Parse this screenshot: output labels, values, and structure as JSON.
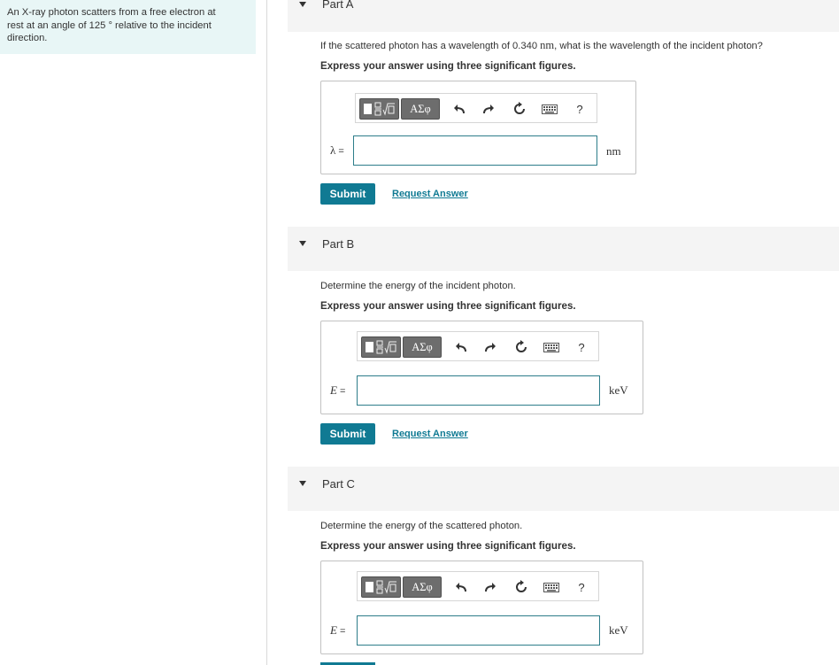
{
  "problem": {
    "line1": "An X-ray photon scatters from a free electron at",
    "line2": "rest at an angle of 125 ° relative to the incident",
    "line3": "direction."
  },
  "toolbar": {
    "symbols_label": "ΑΣφ",
    "help_label": "?",
    "templates_icon": "fraction-sqrt-templates-icon",
    "undo_icon": "undo-arrow-icon",
    "redo_icon": "redo-arrow-icon",
    "reset_icon": "reset-circular-arrow-icon",
    "keyboard_icon": "keyboard-icon"
  },
  "parts": [
    {
      "title": "Part A",
      "question_before": "If the scattered photon has a wavelength of 0.340",
      "question_unit": "nm",
      "question_after": ", what is the wavelength of the incident photon?",
      "instructions": "Express your answer using three significant figures.",
      "variable": "λ",
      "equals": "=",
      "unit": "nm",
      "input_value": "",
      "submit_label": "Submit",
      "request_label": "Request Answer"
    },
    {
      "title": "Part B",
      "question": "Determine the energy of the incident photon.",
      "instructions": "Express your answer using three significant figures.",
      "variable": "E",
      "equals": "=",
      "unit": "keV",
      "input_value": "",
      "submit_label": "Submit",
      "request_label": "Request Answer"
    },
    {
      "title": "Part C",
      "question": "Determine the energy of the scattered photon.",
      "instructions": "Express your answer using three significant figures.",
      "variable": "E",
      "equals": "=",
      "unit": "keV",
      "input_value": ""
    }
  ],
  "colors": {
    "accent": "#107a93",
    "input_border": "#2d7d8a",
    "problem_bg": "#e8f6f6",
    "header_bg": "#f4f4f4"
  }
}
